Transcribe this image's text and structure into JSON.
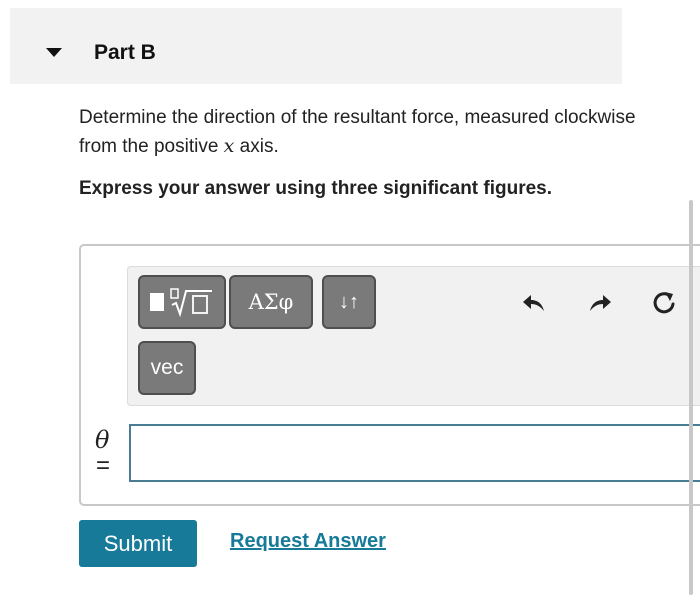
{
  "part": {
    "title": "Part B",
    "toggle_icon": "caret-down-icon"
  },
  "question": {
    "text_before": "Determine the direction of the resultant force, measured clockwise from the positive ",
    "variable": "x",
    "text_after": " axis."
  },
  "instruction": "Express your answer using three significant figures.",
  "toolbar": {
    "templates_icon": "templates-radical-icon",
    "greek_label": "ΑΣφ",
    "arrows_label": "↓↑",
    "vec_label": "vec",
    "undo_icon": "undo-icon",
    "redo_icon": "redo-icon",
    "reset_icon": "reset-icon"
  },
  "answer": {
    "variable": "θ",
    "equals": "=",
    "value": ""
  },
  "actions": {
    "submit_label": "Submit",
    "request_label": "Request Answer"
  },
  "colors": {
    "accent": "#167a98",
    "button_gray": "#7a7a7a",
    "header_bg": "#f2f2f2"
  }
}
